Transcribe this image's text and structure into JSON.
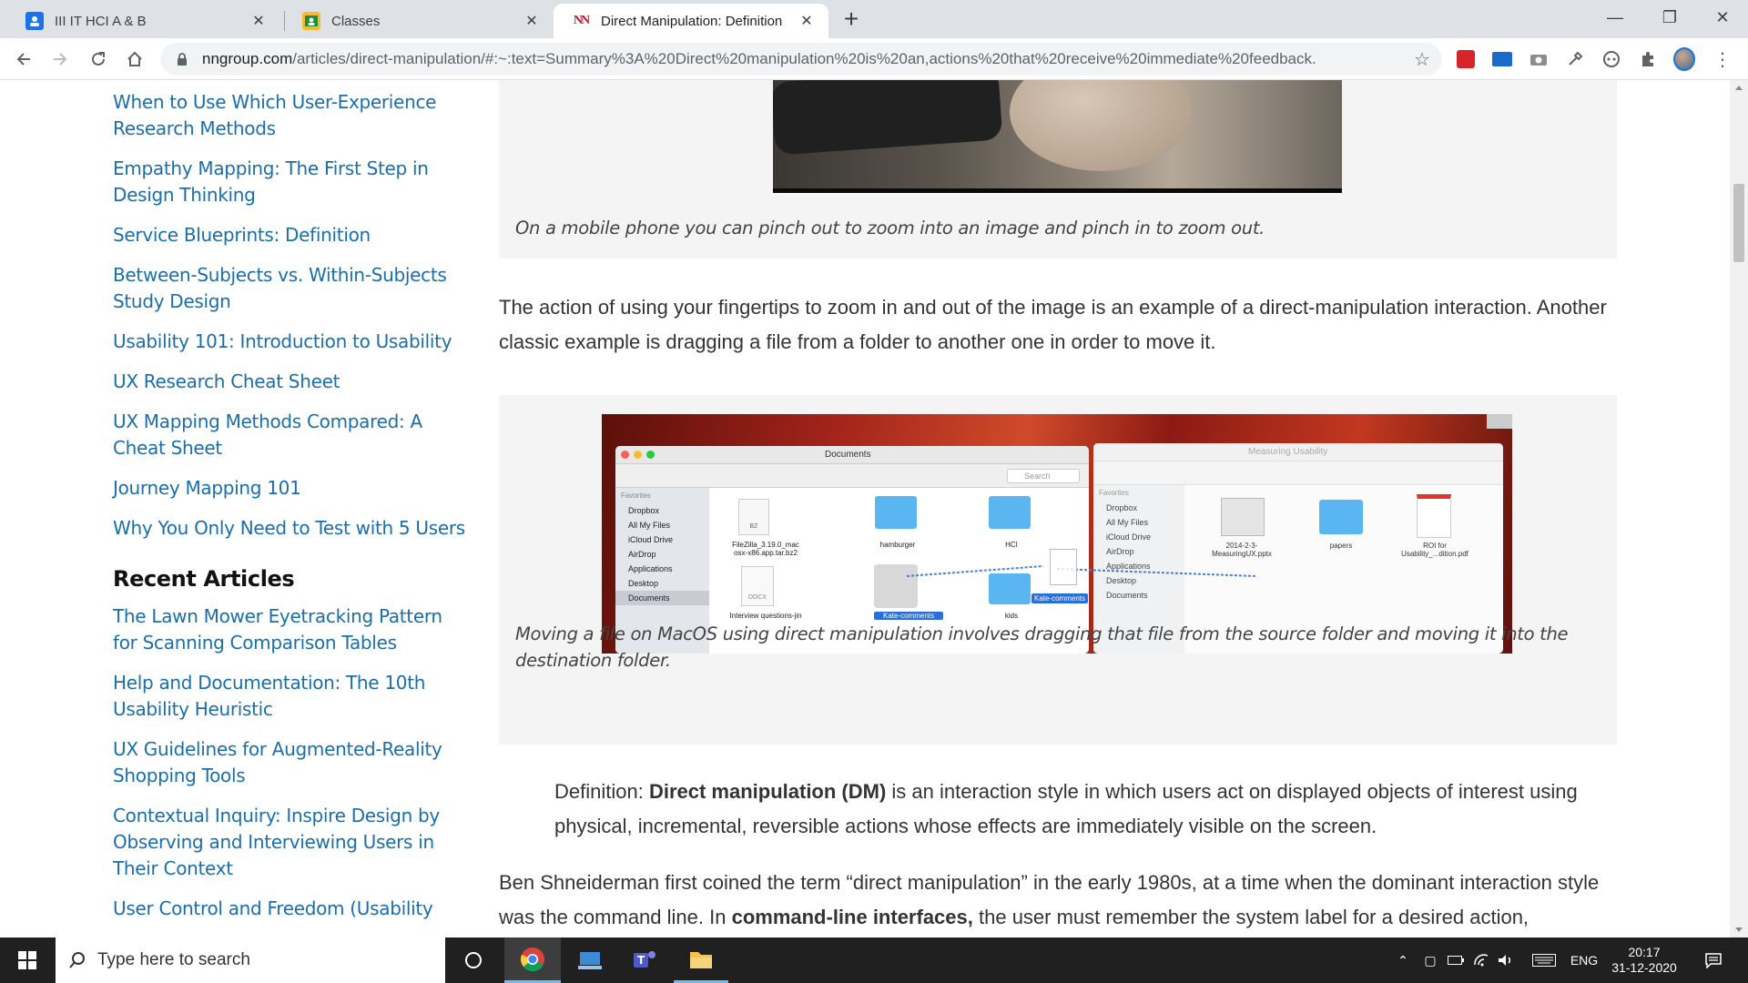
{
  "browser": {
    "tabs": [
      {
        "title": "III IT HCI A & B",
        "icon": "meet-icon",
        "active": false
      },
      {
        "title": "Classes",
        "icon": "classroom-icon",
        "active": false
      },
      {
        "title": "Direct Manipulation: Definition",
        "icon": "nng-icon",
        "favicon_text": "NN",
        "active": true
      }
    ],
    "new_tab": "+",
    "window_controls": {
      "minimize": "—",
      "restore": "❐",
      "close": "✕"
    },
    "url_host": "nngroup.com",
    "url_path": "/articles/direct-manipulation/#:~:text=Summary%3A%20Direct%20manipulation%20is%20an,actions%20that%20receive%20immediate%20feedback."
  },
  "sidebar": {
    "related_links": [
      "When to Use Which User-Experience Research Methods",
      "Empathy Mapping: The First Step in Design Thinking",
      "Service Blueprints: Definition",
      "Between-Subjects vs. Within-Subjects Study Design",
      "Usability 101: Introduction to Usability",
      "UX Research Cheat Sheet",
      "UX Mapping Methods Compared: A Cheat Sheet",
      "Journey Mapping 101",
      "Why You Only Need to Test with 5 Users"
    ],
    "recent_heading": "Recent Articles",
    "recent_links": [
      "The Lawn Mower Eyetracking Pattern for Scanning Comparison Tables",
      "Help and Documentation: The 10th Usability Heuristic",
      "UX Guidelines for Augmented-Reality Shopping Tools",
      "Contextual Inquiry: Inspire Design by Observing and Interviewing Users in Their Context",
      "User Control and Freedom (Usability"
    ]
  },
  "article": {
    "caption1": "On a mobile phone you can pinch out to zoom into an image and pinch in to zoom out.",
    "para1": "The action of using your fingertips to zoom in and out of the image is an example of a direct-manipulation interaction. Another classic example is dragging a file from a folder to another one in order to move it.",
    "figure2": {
      "left_window_title": "Documents",
      "right_window_title": "Measuring Usability",
      "search_placeholder": "Search",
      "favorites_label": "Favorites",
      "left_sidebar": [
        "Dropbox",
        "All My Files",
        "iCloud Drive",
        "AirDrop",
        "Applications",
        "Desktop",
        "Documents"
      ],
      "right_sidebar": [
        "Dropbox",
        "All My Files",
        "iCloud Drive",
        "AirDrop",
        "Applications",
        "Desktop",
        "Documents"
      ],
      "left_files": [
        "FileZilla_3.19.0_mac osx-x86.app.tar.bz2",
        "hamburger",
        "HCI",
        "Interview questions-jin",
        "Kate-comments",
        "kids"
      ],
      "right_files": [
        "2014-2-3-MeasuringUX.pptx",
        "papers",
        "ROI for Usability_...dition.pdf"
      ],
      "drag_label": "Kate-comments",
      "file_type_docx": "DOCX",
      "file_type_bz": "BZ"
    },
    "caption2": "Moving a file on MacOS using direct manipulation involves dragging that file from the source folder and moving it into the destination folder.",
    "definition_prefix": "Definition: ",
    "definition_term": "Direct manipulation (DM)",
    "definition_rest": " is an interaction style in which users act on displayed objects of interest using physical, incremental, reversible actions whose effects are immediately visible on the screen.",
    "para2_start": "Ben Shneiderman first coined the term “direct manipulation” in the early 1980s, at a time when the dominant interaction style was the command line. In ",
    "para2_bold": "command-line interfaces,",
    "para2_end": " the user must remember the system label for a desired action,"
  },
  "taskbar": {
    "search_placeholder": "Type here to search",
    "language": "ENG",
    "time": "20:17",
    "date": "31-12-2020"
  },
  "colors": {
    "link": "#1a6eaa",
    "tab_bar": "#dee1e6",
    "taskbar": "#202020",
    "figure_bg": "#f4f4f4"
  }
}
